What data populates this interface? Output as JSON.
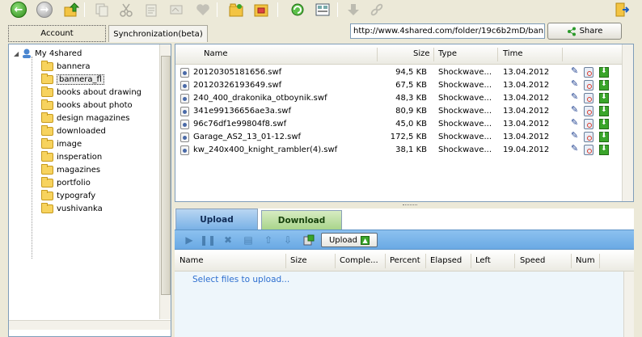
{
  "toolbar": {
    "back_icon": "back-arrow-icon",
    "forward_icon": "forward-arrow-icon",
    "exit_icon": "exit-door-icon"
  },
  "tabs": {
    "account": "Account",
    "sync": "Synchronization(beta)"
  },
  "url_field": {
    "value": "http://www.4shared.com/folder/19c6b2mD/bann"
  },
  "share_button": {
    "label": "Share"
  },
  "tree": {
    "root": "My 4shared",
    "items": [
      {
        "label": "bannera"
      },
      {
        "label": "bannera_fl",
        "selected": true
      },
      {
        "label": "books about drawing"
      },
      {
        "label": "books about photo"
      },
      {
        "label": "design magazines"
      },
      {
        "label": "downloaded"
      },
      {
        "label": "image"
      },
      {
        "label": "insperation"
      },
      {
        "label": "magazines"
      },
      {
        "label": "portfolio"
      },
      {
        "label": "typografy"
      },
      {
        "label": "vushivanka"
      }
    ]
  },
  "files": {
    "columns": {
      "name": "Name",
      "size": "Size",
      "type": "Type",
      "time": "Time"
    },
    "rows": [
      {
        "name": "20120305181656.swf",
        "size": "94,5 KB",
        "type": "Shockwave...",
        "time": "13.04.2012"
      },
      {
        "name": "20120326193649.swf",
        "size": "67,5 KB",
        "type": "Shockwave...",
        "time": "13.04.2012"
      },
      {
        "name": "240_400_drakonika_otboynik.swf",
        "size": "48,3 KB",
        "type": "Shockwave...",
        "time": "13.04.2012"
      },
      {
        "name": "341e99136656ae3a.swf",
        "size": "80,9 KB",
        "type": "Shockwave...",
        "time": "13.04.2012"
      },
      {
        "name": "96c76df1e99804f8.swf",
        "size": "45,0 KB",
        "type": "Shockwave...",
        "time": "13.04.2012"
      },
      {
        "name": "Garage_AS2_13_01-12.swf",
        "size": "172,5 KB",
        "type": "Shockwave...",
        "time": "13.04.2012"
      },
      {
        "name": "kw_240x400_knight_rambler(4).swf",
        "size": "38,1 KB",
        "type": "Shockwave...",
        "time": "19.04.2012"
      }
    ]
  },
  "transfer": {
    "tab_upload": "Upload",
    "tab_download": "Download",
    "upload_button": "Upload",
    "columns": {
      "name": "Name",
      "size": "Size",
      "complete": "Comple...",
      "percent": "Percent",
      "elapsed": "Elapsed",
      "left": "Left",
      "speed": "Speed",
      "num": "Num"
    },
    "hint": "Select files to upload..."
  },
  "colors": {
    "upload_tab": "#79b1e6",
    "download_tab": "#a9d58b",
    "toolbar_bar": "#8cc1ef",
    "hint_link": "#2e6fd0"
  }
}
